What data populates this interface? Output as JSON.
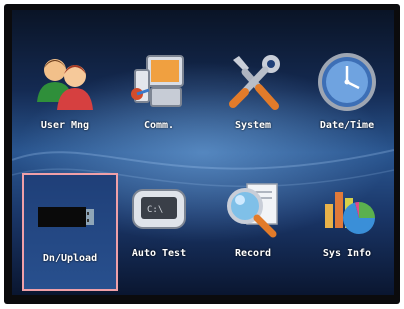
{
  "menu": {
    "items": [
      {
        "label": "User Mng",
        "icon": "users-icon"
      },
      {
        "label": "Comm.",
        "icon": "network-icon"
      },
      {
        "label": "System",
        "icon": "tools-icon"
      },
      {
        "label": "Date/Time",
        "icon": "clock-icon"
      },
      {
        "label": "Dn/Upload",
        "icon": "usb-drive-icon",
        "selected": true
      },
      {
        "label": "Auto Test",
        "icon": "test-device-icon"
      },
      {
        "label": "Record",
        "icon": "magnifier-document-icon"
      },
      {
        "label": "Sys Info",
        "icon": "chart-icon"
      }
    ]
  },
  "colors": {
    "selection_border": "#f0a0a8",
    "label_text": "#ffffff"
  }
}
